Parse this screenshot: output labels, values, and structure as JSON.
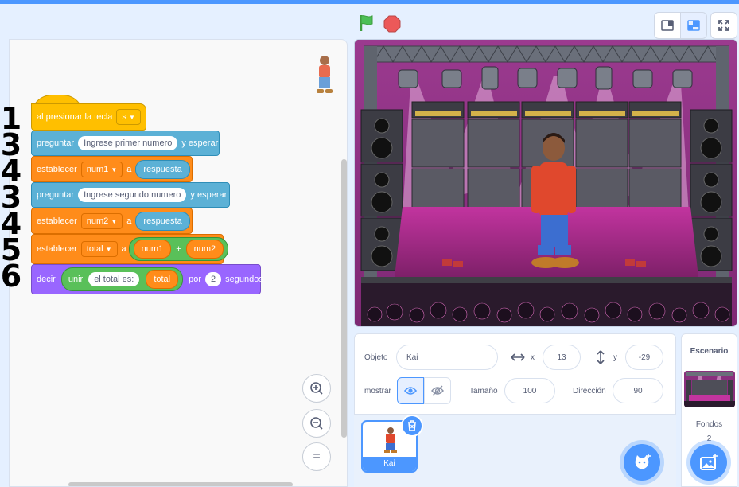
{
  "toolbar": {
    "green_flag_icon": "green-flag-icon",
    "stop_icon": "stop-icon",
    "small_stage_icon": "small-stage-icon",
    "normal_stage_icon": "normal-stage-icon",
    "fullscreen_icon": "fullscreen-icon"
  },
  "annotations": [
    "1",
    "3",
    "4",
    "3",
    "4",
    "5",
    "6"
  ],
  "script": {
    "hat": {
      "text": "al presionar la tecla",
      "key": "s"
    },
    "ask1": {
      "verb": "preguntar",
      "question": "Ingrese primer numero",
      "tail": "y esperar"
    },
    "set1": {
      "verb": "establecer",
      "var": "num1",
      "to": "a",
      "value": "respuesta"
    },
    "ask2": {
      "verb": "preguntar",
      "question": "Ingrese segundo numero",
      "tail": "y esperar"
    },
    "set2": {
      "verb": "establecer",
      "var": "num2",
      "to": "a",
      "value": "respuesta"
    },
    "set3": {
      "verb": "establecer",
      "var": "total",
      "to": "a",
      "left": "num1",
      "op": "+",
      "right": "num2"
    },
    "say": {
      "verb": "decir",
      "join": "unir",
      "text": "el total es:",
      "var": "total",
      "for": "por",
      "secs": "2",
      "unit": "segundos"
    }
  },
  "zoom_controls": {
    "zoom_in_icon": "zoom-in-icon",
    "zoom_out_icon": "zoom-out-icon",
    "reset_icon": "zoom-reset-icon",
    "reset_symbol": "="
  },
  "sprite_info": {
    "object_label": "Objeto",
    "object_name": "Kai",
    "x_label": "x",
    "x_value": "13",
    "y_label": "y",
    "y_value": "-29",
    "show_label": "mostrar",
    "size_label": "Tamaño",
    "size_value": "100",
    "direction_label": "Dirección",
    "direction_value": "90"
  },
  "sprites": [
    {
      "name": "Kai"
    }
  ],
  "stage_panel": {
    "title": "Escenario",
    "backdrops_label": "Fondos",
    "backdrops_count": "2"
  },
  "colors": {
    "accent": "#4c97ff",
    "events": "#ffbf00",
    "sensing": "#5cb1d6",
    "variables": "#ff8c1a",
    "looks": "#9966ff",
    "operators": "#59c059"
  }
}
